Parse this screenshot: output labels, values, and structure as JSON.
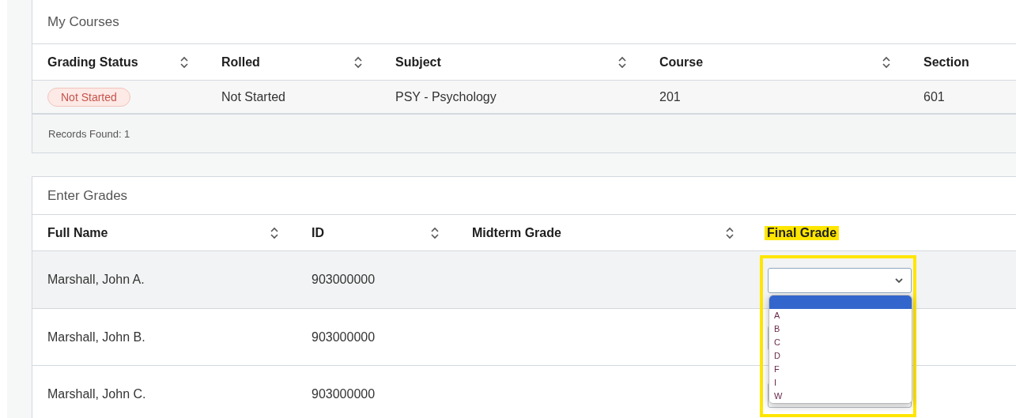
{
  "my_courses": {
    "title": "My Courses",
    "columns": [
      {
        "label": "Grading Status",
        "sortable": true
      },
      {
        "label": "Rolled",
        "sortable": true
      },
      {
        "label": "Subject",
        "sortable": true
      },
      {
        "label": "Course",
        "sortable": true
      },
      {
        "label": "Section"
      }
    ],
    "rows": [
      {
        "grading_status": "Not Started",
        "rolled": "Not Started",
        "subject": "PSY - Psychology",
        "course": "201",
        "section": "601"
      }
    ],
    "footer": "Records Found: 1"
  },
  "enter_grades": {
    "title": "Enter Grades",
    "columns": [
      {
        "label": "Full Name",
        "sortable": true,
        "highlighted": false
      },
      {
        "label": "ID",
        "sortable": true,
        "highlighted": false
      },
      {
        "label": "Midterm Grade",
        "sortable": true,
        "highlighted": false
      },
      {
        "label": "Final Grade",
        "sortable": false,
        "highlighted": true
      }
    ],
    "rows": [
      {
        "full_name": "Marshall, John A.",
        "id": "903000000",
        "selected": true
      },
      {
        "full_name": "Marshall, John B.",
        "id": "903000000",
        "selected": false
      },
      {
        "full_name": "Marshall, John C.",
        "id": "903000000",
        "selected": false
      }
    ],
    "final_grade_dropdown": {
      "expanded": true,
      "highlighted": true,
      "blank_option": {
        "selected": true
      },
      "options": [
        {
          "label": "A",
          "selected": false
        },
        {
          "label": "B",
          "selected": false
        },
        {
          "label": "C",
          "selected": false
        },
        {
          "label": "D",
          "selected": false
        },
        {
          "label": "F",
          "selected": false
        },
        {
          "label": "I",
          "selected": false
        },
        {
          "label": "W",
          "selected": false
        }
      ]
    }
  }
}
